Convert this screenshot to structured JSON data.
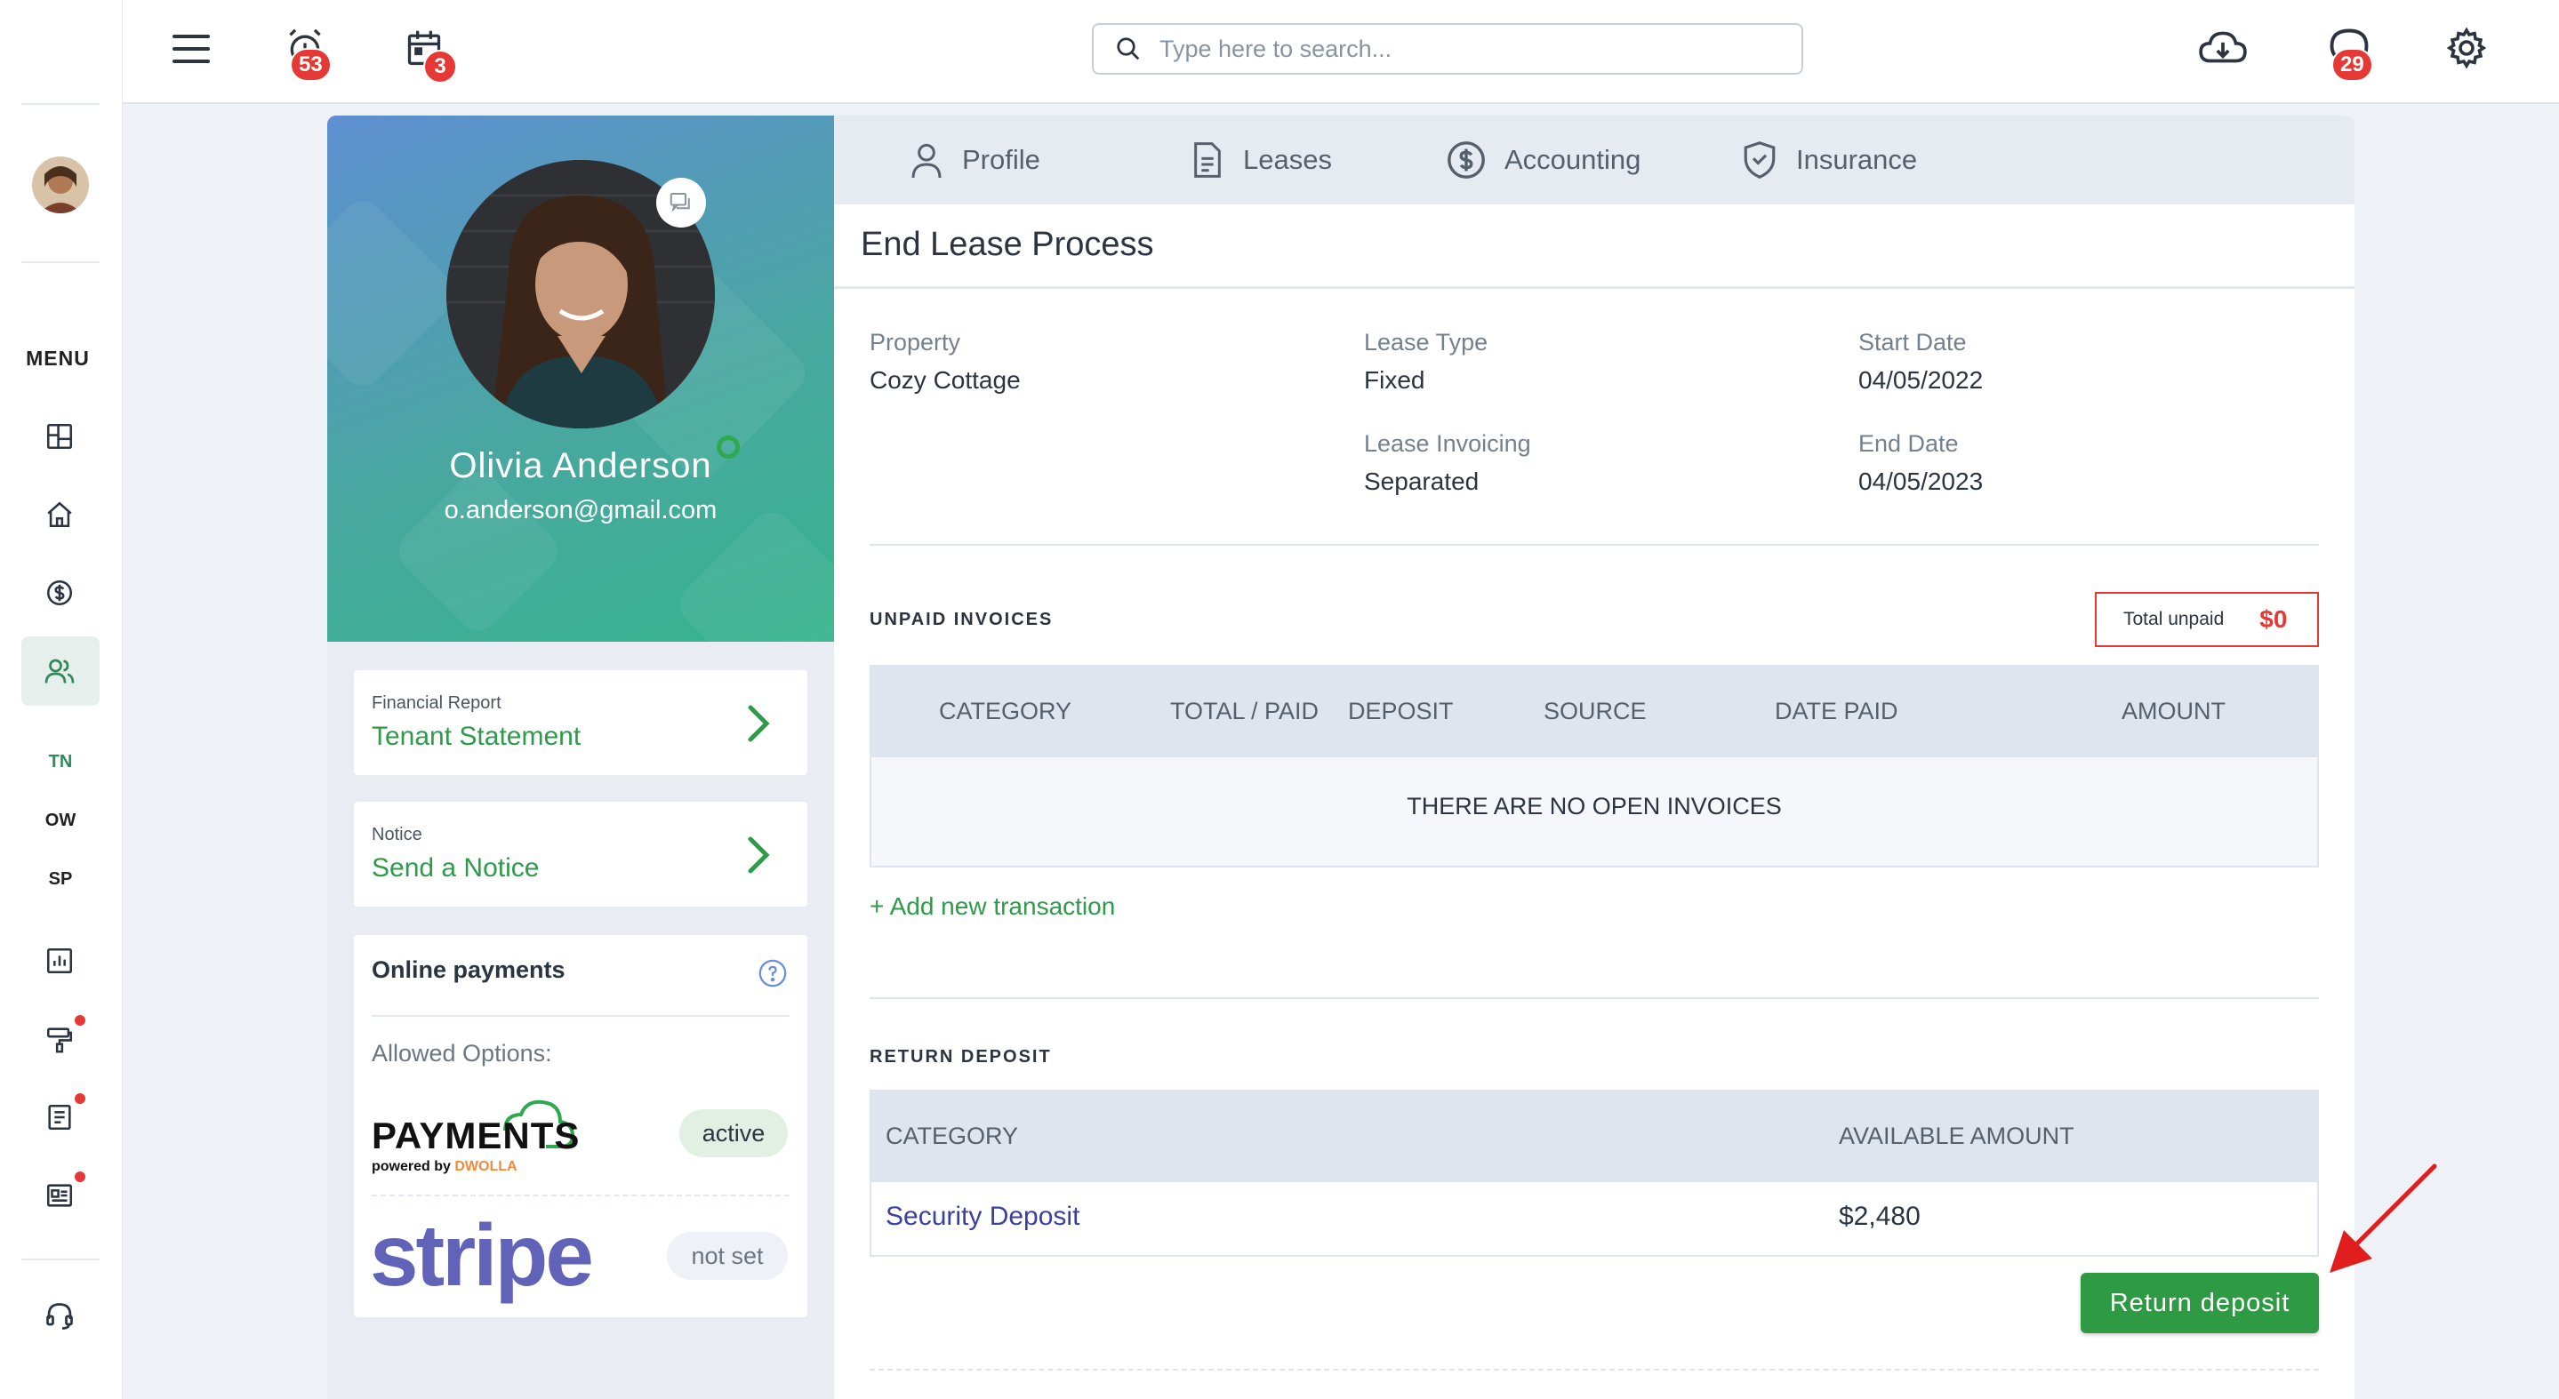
{
  "sidebar": {
    "menu_label": "MENU",
    "shortcuts": [
      "TN",
      "OW",
      "SP"
    ]
  },
  "topbar": {
    "alarm_count": "53",
    "calendar_count": "3",
    "chat_count": "29",
    "search_placeholder": "Type here to search..."
  },
  "profile": {
    "name": "Olivia Anderson",
    "email": "o.anderson@gmail.com"
  },
  "links": [
    {
      "small": "Financial Report",
      "label": "Tenant Statement"
    },
    {
      "small": "Notice",
      "label": "Send a Notice"
    }
  ],
  "online_payments": {
    "title": "Online payments",
    "allowed_label": "Allowed Options:",
    "options": [
      {
        "name": "PAYMENTS",
        "sub": "powered by",
        "sub_brand": "DWOLLA",
        "status": "active"
      },
      {
        "name": "stripe",
        "status": "not set"
      }
    ]
  },
  "tabs": [
    "Profile",
    "Leases",
    "Accounting",
    "Insurance"
  ],
  "page_title": "End Lease Process",
  "lease": {
    "property_label": "Property",
    "property": "Cozy Cottage",
    "lease_type_label": "Lease Type",
    "lease_type": "Fixed",
    "start_date_label": "Start Date",
    "start_date": "04/05/2022",
    "lease_invoicing_label": "Lease Invoicing",
    "lease_invoicing": "Separated",
    "end_date_label": "End Date",
    "end_date": "04/05/2023"
  },
  "unpaid": {
    "heading": "UNPAID INVOICES",
    "total_label": "Total unpaid",
    "total_value": "$0",
    "columns": [
      "CATEGORY",
      "TOTAL / PAID",
      "DEPOSIT",
      "SOURCE",
      "DATE PAID",
      "AMOUNT"
    ],
    "empty_message": "THERE ARE NO OPEN INVOICES",
    "add_link": "+ Add new transaction"
  },
  "return_deposit": {
    "heading": "RETURN DEPOSIT",
    "columns": [
      "CATEGORY",
      "AVAILABLE AMOUNT"
    ],
    "rows": [
      {
        "category": "Security Deposit",
        "amount": "$2,480"
      }
    ],
    "button": "Return deposit"
  },
  "colors": {
    "accent_green": "#2f9a44",
    "alert_red": "#e53935",
    "link_blue": "#3b3f9e"
  }
}
